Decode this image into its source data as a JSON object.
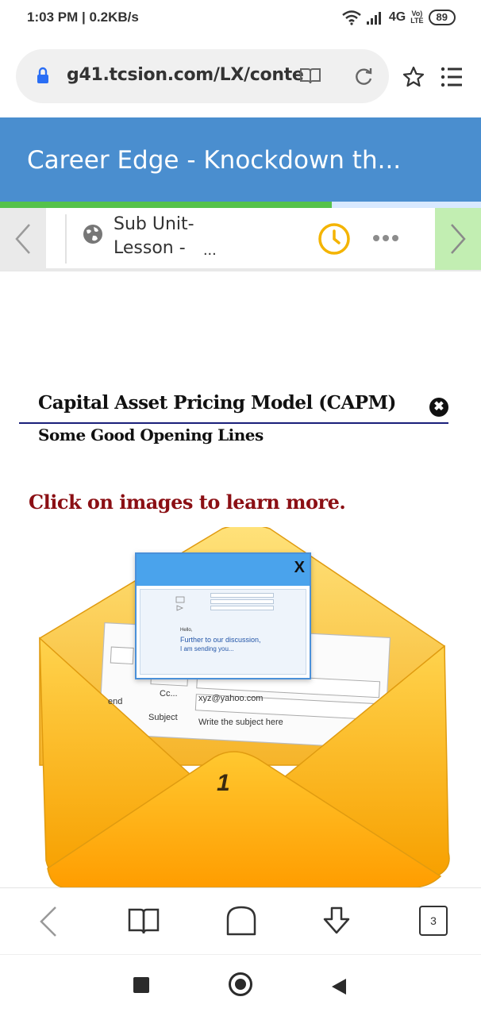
{
  "status_bar": {
    "time": "1:03 PM",
    "speed": "0.2KB/s",
    "network": "4G",
    "volte_line1": "Vo)",
    "volte_line2": "LTE",
    "battery": "89"
  },
  "browser": {
    "url": "g41.tcsion.com/LX/conte",
    "tab_count": "3"
  },
  "course": {
    "title": "Career Edge - Knockdown th...",
    "progress_fraction": 0.69
  },
  "lesson_nav": {
    "sub_unit": "Sub Unit-",
    "lesson": "Lesson -",
    "ellipsis": "..."
  },
  "content": {
    "topic_title": "Capital Asset Pricing Model (CAPM)",
    "topic_subtitle": "Some Good Opening Lines",
    "click_hint": "Click on images to learn more.",
    "close_symbol": "✖"
  },
  "illustration": {
    "popup_close": "X",
    "popup_hello": "Hello,",
    "popup_line1": "Further to our discussion,",
    "popup_line2": "I am sending you...",
    "cc_label": "Cc...",
    "cc_value": "xyz@yahoo.com",
    "subject_label": "Subject",
    "subject_value": "Write the subject here",
    "send_label": "end",
    "number": "1"
  },
  "colors": {
    "banner": "#4a8ecf",
    "progress": "#55c24a",
    "hint": "#8b0f14",
    "next_button": "#c2eeb2",
    "envelope_light": "#ffd24a",
    "envelope_dark": "#f7a400",
    "clock": "#f4b400"
  },
  "icons": [
    "lock-icon",
    "reader-icon",
    "reload-icon",
    "star-icon",
    "menu-icon",
    "globe-icon",
    "clock-icon",
    "more-icon",
    "close-icon",
    "back-icon",
    "bookmarks-icon",
    "home-icon",
    "download-icon"
  ]
}
